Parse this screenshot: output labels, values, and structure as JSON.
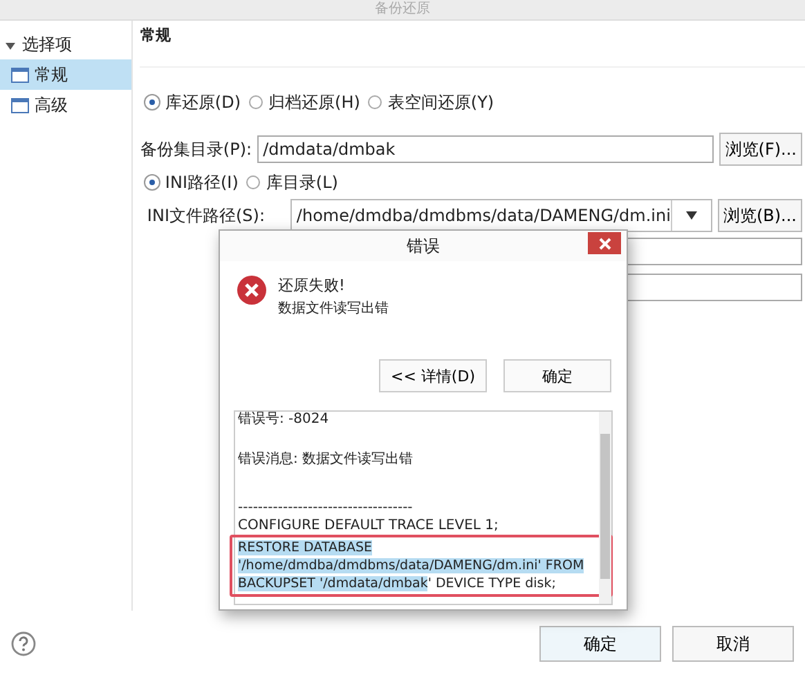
{
  "window": {
    "title": "备份还原"
  },
  "sidebar": {
    "header": {
      "label": "选择项",
      "expanded": true
    },
    "items": [
      {
        "label": "常规",
        "selected": true
      },
      {
        "label": "高级",
        "selected": false
      }
    ]
  },
  "section_title": "常规",
  "restore_types": [
    {
      "label": "库还原(D)",
      "selected": true
    },
    {
      "label": "归档还原(H)",
      "selected": false
    },
    {
      "label": "表空间还原(Y)",
      "selected": false
    }
  ],
  "backup_dir": {
    "label": "备份集目录(P):",
    "value": "/dmdata/dmbak",
    "button": "浏览(F)..."
  },
  "path_types": [
    {
      "label": "INI路径(I)",
      "selected": true
    },
    {
      "label": "库目录(L)",
      "selected": false
    }
  ],
  "ini_path": {
    "label": "INI文件路径(S):",
    "value": "/home/dmdba/dmdbms/data/DAMENG/dm.ini",
    "button": "浏览(B)..."
  },
  "dialog": {
    "title": "错误",
    "heading": "还原失败!",
    "message": "数据文件读写出错",
    "buttons": [
      "<< 详情(D)",
      "确定"
    ],
    "details": [
      {
        "text": "错误号: -8024",
        "kind": "line"
      },
      {
        "text": "错误消息: 数据文件读写出错",
        "kind": "line"
      },
      {
        "text": "-----------------------------------",
        "kind": "line"
      },
      {
        "text": "CONFIGURE DEFAULT TRACE LEVEL 1;",
        "kind": "line"
      },
      {
        "kind": "statement",
        "selected_text": "RESTORE DATABASE  '/home/dmdba/dmdbms/data/DAMENG/dm.ini' FROM BACKUPSET '/dmdata/dmbak",
        "text": "' DEVICE TYPE disk;",
        "highlighted": true
      }
    ]
  },
  "footer": {
    "buttons": [
      {
        "label": "确定",
        "kind": "primary"
      },
      {
        "label": "取消",
        "kind": "secondary"
      }
    ]
  }
}
